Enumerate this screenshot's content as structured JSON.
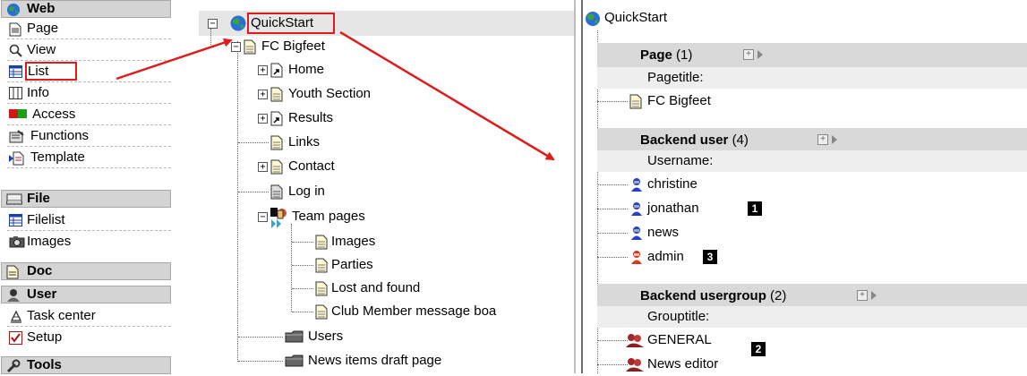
{
  "menu": {
    "sections": {
      "web": "Web",
      "file": "File",
      "doc": "Doc",
      "user": "User",
      "tools": "Tools"
    },
    "web_items": [
      "Page",
      "View",
      "List",
      "Info",
      "Access",
      "Functions",
      "Template"
    ],
    "file_items": [
      "Filelist",
      "Images"
    ],
    "user_items": [
      "Task center",
      "Setup"
    ]
  },
  "tree": {
    "root": "QuickStart",
    "site": "FC Bigfeet",
    "pages": [
      "Home",
      "Youth Section",
      "Results",
      "Links",
      "Contact",
      "Log in",
      "Team pages"
    ],
    "team_children": [
      "Images",
      "Parties",
      "Lost and found",
      "Club Member message boa"
    ],
    "bottom": [
      "Users",
      "News items draft page"
    ]
  },
  "list": {
    "root": "QuickStart",
    "page_table": {
      "title": "Page",
      "count": "(1)",
      "column": "Pagetitle:",
      "rows": [
        "FC Bigfeet"
      ]
    },
    "user_table": {
      "title": "Backend user",
      "count": "(4)",
      "column": "Username:",
      "rows": [
        "christine",
        "jonathan",
        "news",
        "admin"
      ]
    },
    "group_table": {
      "title": "Backend usergroup",
      "count": "(2)",
      "column": "Grouptitle:",
      "rows": [
        "GENERAL",
        "News editor"
      ]
    },
    "badges": {
      "jonathan": "1",
      "admin": "3",
      "group": "2"
    }
  },
  "colors": {
    "highlight": "#e01b1b",
    "header_bg": "#d9d9d9",
    "section_bg": "#d4d4d4"
  }
}
